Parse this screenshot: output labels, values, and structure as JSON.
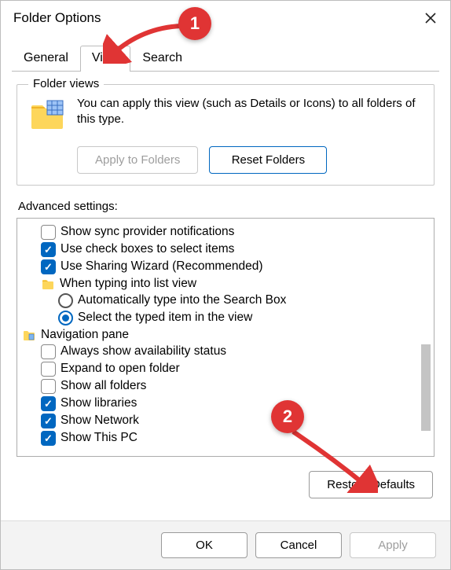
{
  "window": {
    "title": "Folder Options"
  },
  "tabs": {
    "general": "General",
    "view": "View",
    "search": "Search",
    "active": "view"
  },
  "folderViews": {
    "legend": "Folder views",
    "desc": "You can apply this view (such as Details or Icons) to all folders of this type.",
    "applyBtn": "Apply to Folders",
    "resetBtn": "Reset Folders"
  },
  "adv": {
    "label": "Advanced settings:",
    "items": [
      {
        "type": "check",
        "checked": false,
        "label": "Show sync provider notifications"
      },
      {
        "type": "check",
        "checked": true,
        "label": "Use check boxes to select items"
      },
      {
        "type": "check",
        "checked": true,
        "label": "Use Sharing Wizard (Recommended)"
      },
      {
        "type": "group",
        "icon": "folder",
        "label": "When typing into list view"
      },
      {
        "type": "radio",
        "checked": false,
        "label": "Automatically type into the Search Box"
      },
      {
        "type": "radio",
        "checked": true,
        "label": "Select the typed item in the view"
      },
      {
        "type": "group",
        "icon": "navpane",
        "label": "Navigation pane",
        "outdent": true
      },
      {
        "type": "check",
        "checked": false,
        "label": "Always show availability status"
      },
      {
        "type": "check",
        "checked": false,
        "label": "Expand to open folder"
      },
      {
        "type": "check",
        "checked": false,
        "label": "Show all folders"
      },
      {
        "type": "check",
        "checked": true,
        "label": "Show libraries"
      },
      {
        "type": "check",
        "checked": true,
        "label": "Show Network"
      },
      {
        "type": "check",
        "checked": true,
        "label": "Show This PC"
      }
    ],
    "restoreBtn": "Restore Defaults"
  },
  "footer": {
    "ok": "OK",
    "cancel": "Cancel",
    "apply": "Apply"
  },
  "annotations": {
    "bubble1": "1",
    "bubble2": "2"
  }
}
